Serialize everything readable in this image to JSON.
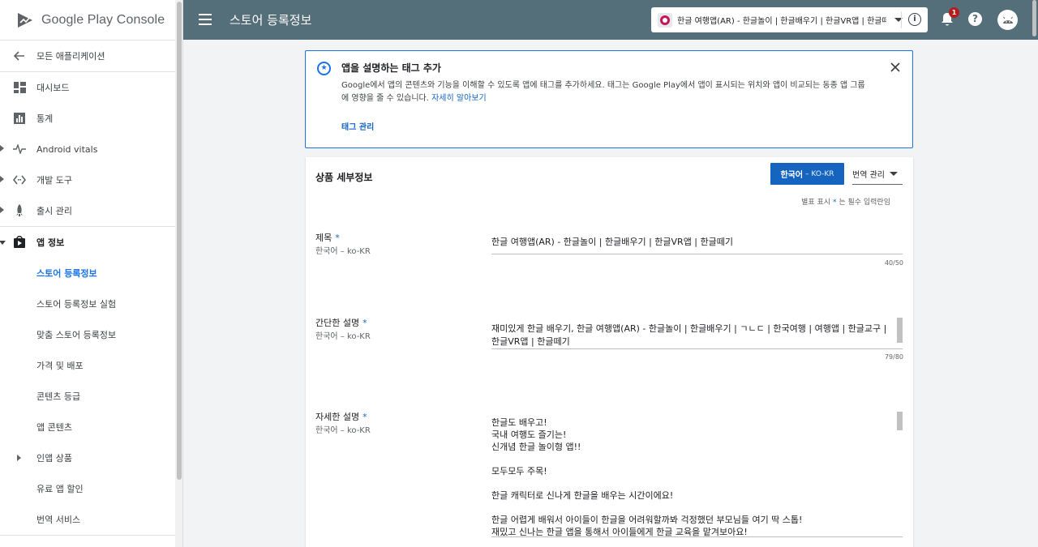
{
  "app": {
    "brand": "Google Play Console"
  },
  "sidebar": {
    "items": [
      {
        "label": "모든 애플리케이션",
        "icon": "arrow-back-icon"
      },
      {
        "label": "대시보드",
        "icon": "dashboard-icon"
      },
      {
        "label": "통계",
        "icon": "bar-chart-icon"
      },
      {
        "label": "Android vitals",
        "icon": "pulse-icon"
      },
      {
        "label": "개발 도구",
        "icon": "code-icon"
      },
      {
        "label": "출시 관리",
        "icon": "rocket-icon"
      },
      {
        "label": "앱 정보",
        "icon": "play-store-icon"
      },
      {
        "label": "스토어 등록정보"
      },
      {
        "label": "스토어 등록정보 실험"
      },
      {
        "label": "맞춤 스토어 등록정보"
      },
      {
        "label": "가격 및 배포"
      },
      {
        "label": "콘텐츠 등급"
      },
      {
        "label": "앱 콘텐츠"
      },
      {
        "label": "인앱 상품"
      },
      {
        "label": "유료 앱 할인"
      },
      {
        "label": "번역 서비스"
      }
    ]
  },
  "header": {
    "title": "스토어 등록정보",
    "app_name": "한글 여행앱(AR) - 한글놀이 | 한글배우기 | 한글VR앱 | 한글떼기",
    "notification_count": "1",
    "help_label": "?",
    "info_label": "i"
  },
  "banner": {
    "title": "앱을 설명하는 태그 추가",
    "body": "Google에서 앱의 콘텐츠와 기능을 이해할 수 있도록 앱에 태그를 추가하세요. 태그는 Google Play에서 앱이 표시되는 위치와 앱이 비교되는 동종 앱 그룹에 영향을 줄 수 있습니다.",
    "link": "자세히 알아보기",
    "action": "태그 관리"
  },
  "details": {
    "title": "상품 세부정보",
    "language_button": "한국어",
    "language_code": "– KO-KR",
    "translate_button": "번역 관리",
    "required_note_prefix": "별표 표시",
    "required_star": "*",
    "required_note_suffix": "는 필수 입력란임",
    "fields": {
      "title": {
        "label": "제목",
        "star": "*",
        "lang": "한국어 – ko-KR",
        "value": "한글 여행앱(AR) - 한글놀이 | 한글배우기 | 한글VR앱 | 한글떼기",
        "count": "40/50"
      },
      "short": {
        "label": "간단한 설명",
        "star": "*",
        "lang": "한국어 – ko-KR",
        "value": "재미있게 한글 배우기, 한글 여행앱(AR) - 한글놀이 | 한글배우기 | ㄱㄴㄷ | 한국여행 | 여행앱 | 한글교구 | 한글VR앱 | 한글떼기",
        "count": "79/80"
      },
      "full": {
        "label": "자세한 설명",
        "star": "*",
        "lang": "한국어 – ko-KR",
        "lines": [
          "한글도 배우고!",
          "국내 여행도 즐기는!",
          "신개념 한글 놀이형 앱!!",
          "",
          "모두모두 주목!",
          "",
          "한글 캐릭터로 신나게 한글을 배우는 시간이에요!",
          "",
          "한글 어렵게 배워서 아이들이 한글을 어려워할까봐 걱정했던 부모님들 여기 딱 스톱!",
          "재밌고 신나는 한글 앱을 통해서 아이들에게 한글 교육을 맡겨보아요!"
        ]
      }
    }
  }
}
